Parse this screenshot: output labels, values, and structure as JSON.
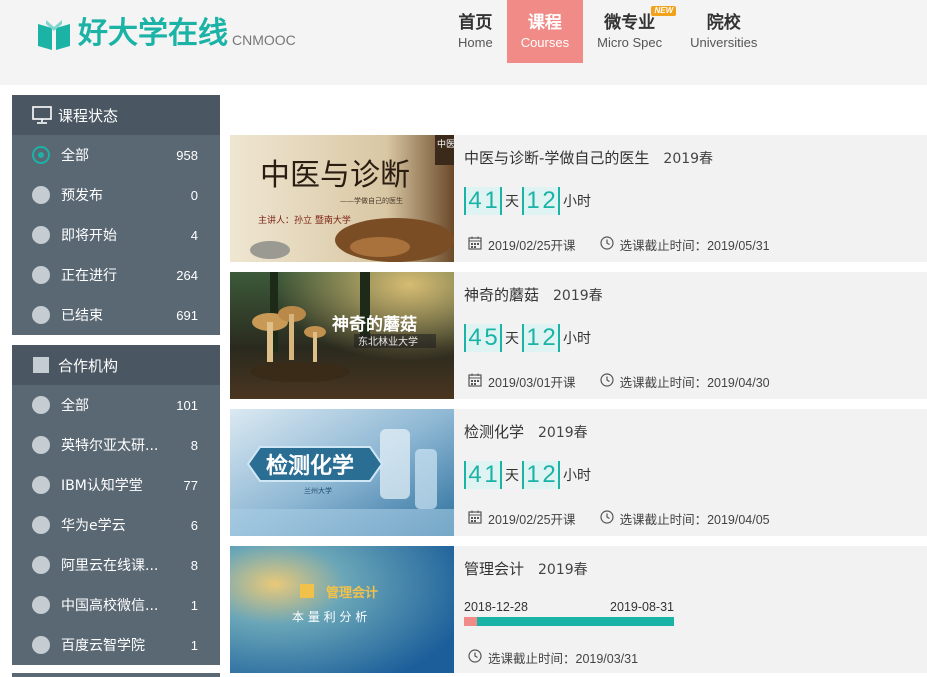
{
  "header": {
    "logo_text": "好大学在线",
    "logo_sub": "CNMOOC",
    "nav": [
      {
        "zh": "首页",
        "en": "Home"
      },
      {
        "zh": "课程",
        "en": "Courses"
      },
      {
        "zh": "微专业",
        "en": "Micro Spec",
        "badge": "NEW"
      },
      {
        "zh": "院校",
        "en": "Universities"
      }
    ],
    "active_nav_index": 1
  },
  "sidebar": {
    "status": {
      "title": "课程状态",
      "items": [
        {
          "label": "全部",
          "count": "958",
          "selected": true
        },
        {
          "label": "预发布",
          "count": "0"
        },
        {
          "label": "即将开始",
          "count": "4"
        },
        {
          "label": "正在进行",
          "count": "264"
        },
        {
          "label": "已结束",
          "count": "691"
        }
      ]
    },
    "partners": {
      "title": "合作机构",
      "items": [
        {
          "label": "全部",
          "count": "101"
        },
        {
          "label": "英特尔亚太研...",
          "count": "8"
        },
        {
          "label": "IBM认知学堂",
          "count": "77"
        },
        {
          "label": "华为e学云",
          "count": "6"
        },
        {
          "label": "阿里云在线课...",
          "count": "8"
        },
        {
          "label": "中国高校微信...",
          "count": "1"
        },
        {
          "label": "百度云智学院",
          "count": "1"
        }
      ]
    }
  },
  "courses": [
    {
      "title": "中医与诊断-学做自己的医生",
      "term": "2019春",
      "days": [
        "4",
        "1"
      ],
      "day_unit": "天",
      "hours": [
        "1",
        "2"
      ],
      "hour_unit": "小时",
      "start": "2019/02/25开课",
      "deadline": "选课截止时间：2019/05/31",
      "thumb": {
        "line1": "中医与诊断",
        "line2": "——学做自己的医生",
        "line3": "主讲人：孙立  暨南大学",
        "corner": "中医"
      }
    },
    {
      "title": "神奇的蘑菇",
      "term": "2019春",
      "days": [
        "4",
        "5"
      ],
      "day_unit": "天",
      "hours": [
        "1",
        "2"
      ],
      "hour_unit": "小时",
      "start": "2019/03/01开课",
      "deadline": "选课截止时间：2019/04/30",
      "thumb": {
        "line1": "神奇的蘑菇",
        "line2": "东北林业大学"
      }
    },
    {
      "title": "检测化学",
      "term": "2019春",
      "days": [
        "4",
        "1"
      ],
      "day_unit": "天",
      "hours": [
        "1",
        "2"
      ],
      "hour_unit": "小时",
      "start": "2019/02/25开课",
      "deadline": "选课截止时间：2019/04/05",
      "thumb": {
        "line1": "检测化学",
        "line2": "兰州大学"
      }
    },
    {
      "title": "管理会计",
      "term": "2019春",
      "tl_start": "2018-12-28",
      "tl_end": "2019-08-31",
      "progress": 0.06,
      "deadline": "选课截止时间：2019/03/31",
      "thumb": {
        "line1": "管理会计",
        "line2": "本 量 利 分 析"
      }
    }
  ],
  "colors": {
    "accent": "#1ab3a6",
    "active_nav": "#f08b87",
    "sidebar": "#5a6874",
    "sidebar_head": "#4a5661"
  }
}
